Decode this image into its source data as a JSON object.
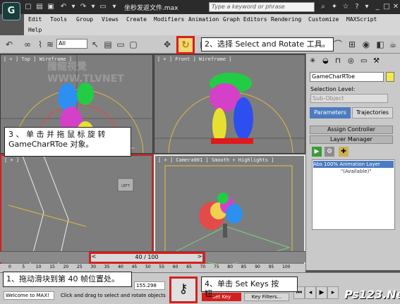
{
  "app": {
    "logo_text": "G",
    "file_title": "坐秒发返文件.max",
    "search_placeholder": "Type a keyword or phrase"
  },
  "menu": {
    "row1": [
      "Edit",
      "Tools",
      "Group",
      "Views",
      "Create",
      "Modifiers",
      "Animation",
      "Graph Editors",
      "Rendering",
      "Customize",
      "MAXScript"
    ],
    "row2": [
      "Help"
    ]
  },
  "toolbar": {
    "selection_filter": "All"
  },
  "callouts": {
    "c1": "2、选择 Select and Rotate 工具。",
    "c2_line1": "3 、 单 击 并 拖 鼠 标 旋 转",
    "c2_line2": "GameCharRToe 对象。",
    "c3": "1、拖动滑块到第 40 帧位置处。",
    "c4": "4、单击 Set Keys 按钮。"
  },
  "viewports": {
    "top_label": "[ + ] Top ] Wireframe ]",
    "front_label": "[ + ] Front ] Wireframe ]",
    "left_label": "[ + ]",
    "camera_label": "[ + ] Camera001 ] Smooth + Highlights ]",
    "left_cube_label": "LEFT",
    "watermark": "騰龍視覺 WWW.TLVNET"
  },
  "command_panel": {
    "object_name": "GameCharRToe",
    "selection_level_label": "Selection Level:",
    "sub_object_placeholder": "Sub-Object",
    "tab_parameters": "Parameters",
    "tab_trajectories": "Trajectories",
    "rollout_assign": "Assign Controller",
    "rollout_layer": "Layer Manager",
    "layer1": "100% Animation Layer",
    "layer2": "\"(Available)\"",
    "abs_label": "Abs"
  },
  "timeline": {
    "slider_text": "40 / 100",
    "ticks": [
      "0",
      "5",
      "10",
      "15",
      "20",
      "25",
      "30",
      "35",
      "40",
      "45",
      "50",
      "55",
      "60",
      "65",
      "70",
      "75",
      "80",
      "85",
      "90",
      "95",
      "100"
    ]
  },
  "status": {
    "welcome": "Welcome to MAX!",
    "prompt": "Click and drag to select and rotate objects",
    "coord": "155.298",
    "set_key": "Set Key",
    "key_filters": "Key Filters..."
  },
  "branding": {
    "site": "Ps123.Net"
  },
  "colors": {
    "highlight_red": "#d51f1f",
    "active_tab": "#4c7bc0",
    "object_swatch": "#f3e94a"
  }
}
